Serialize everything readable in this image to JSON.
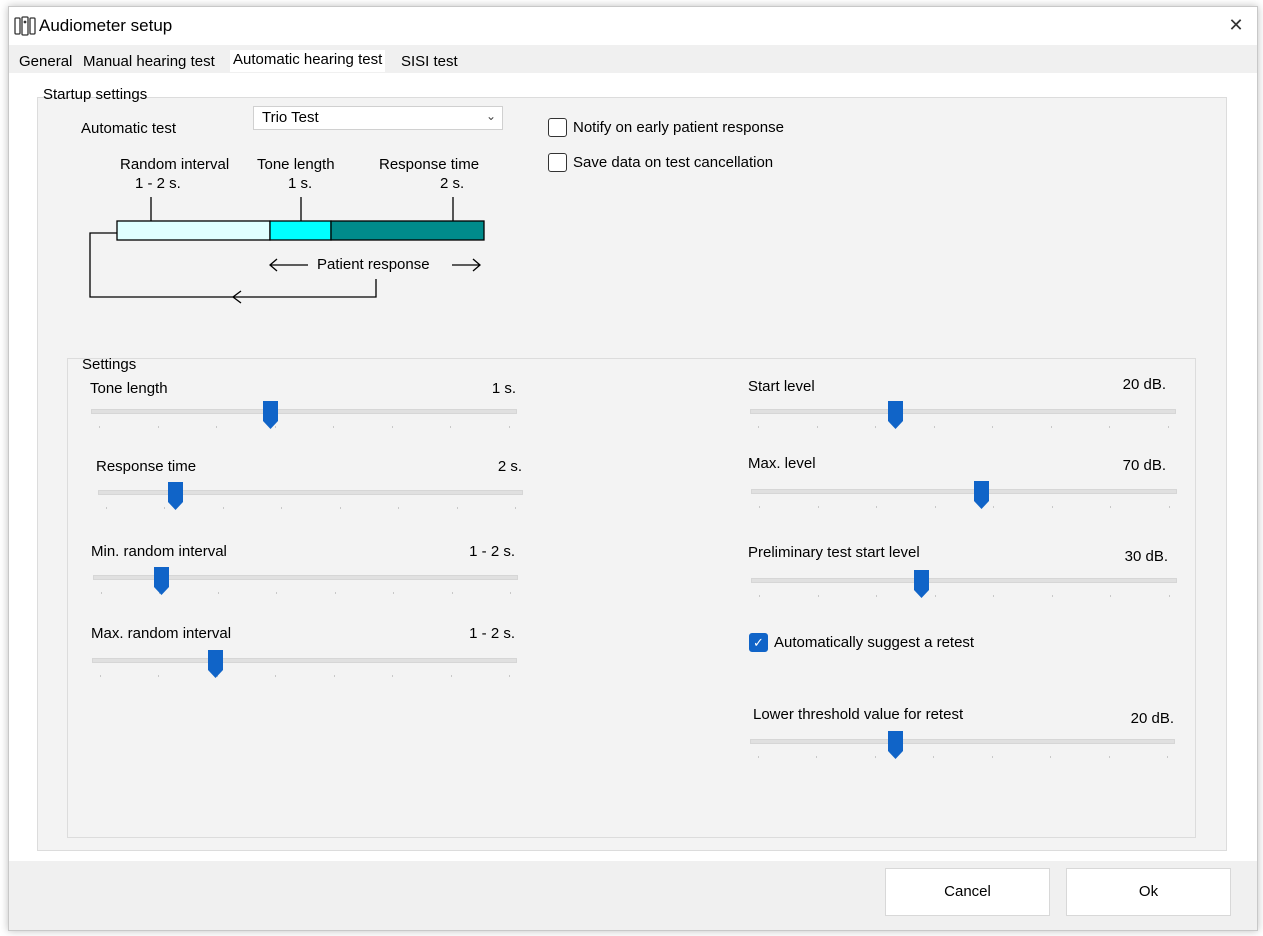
{
  "window": {
    "title": "Audiometer setup",
    "close_symbol": "✕"
  },
  "tabs": [
    {
      "label": "General"
    },
    {
      "label": "Manual hearing test"
    },
    {
      "label": "Automatic hearing test",
      "active": true
    },
    {
      "label": "SISI test"
    }
  ],
  "startup": {
    "group_label": "Startup settings",
    "automatic_test_label": "Automatic test",
    "automatic_test_value": "Trio Test",
    "notify_label": "Notify on early patient response",
    "notify_checked": false,
    "save_label": "Save data on test cancellation",
    "save_checked": false,
    "diagram": {
      "random_interval_label": "Random interval",
      "random_interval_value": "1 - 2 s.",
      "tone_length_label": "Tone length",
      "tone_length_value": "1 s.",
      "response_time_label": "Response time",
      "response_time_value": "2 s.",
      "patient_response_label": "Patient response",
      "colors": {
        "random": "#e0ffff",
        "tone": "#00ffff",
        "response": "#008b8b"
      }
    }
  },
  "settings": {
    "group_label": "Settings",
    "sliders": [
      {
        "name": "tone-length",
        "label": "Tone length",
        "value_text": "1 s.",
        "position": 0.42
      },
      {
        "name": "response-time",
        "label": "Response time",
        "value_text": "2 s.",
        "position": 0.18
      },
      {
        "name": "min-random-interval",
        "label": "Min. random interval",
        "value_text": "1 - 2 s.",
        "position": 0.16
      },
      {
        "name": "max-random-interval",
        "label": "Max. random interval",
        "value_text": "1 - 2 s.",
        "position": 0.29
      },
      {
        "name": "start-level",
        "label": "Start level",
        "value_text": "20 dB.",
        "position": 0.34
      },
      {
        "name": "max-level",
        "label": "Max. level",
        "value_text": "70 dB.",
        "position": 0.54
      },
      {
        "name": "preliminary-test-start-level",
        "label": "Preliminary test start level",
        "value_text": "30 dB.",
        "position": 0.4
      },
      {
        "name": "lower-threshold-retest",
        "label": "Lower threshold value for retest",
        "value_text": "20 dB.",
        "position": 0.34
      }
    ],
    "suggest_retest_label": "Automatically suggest a retest",
    "suggest_retest_checked": true
  },
  "buttons": {
    "cancel": "Cancel",
    "ok": "Ok"
  },
  "accent_color": "#1064c8"
}
